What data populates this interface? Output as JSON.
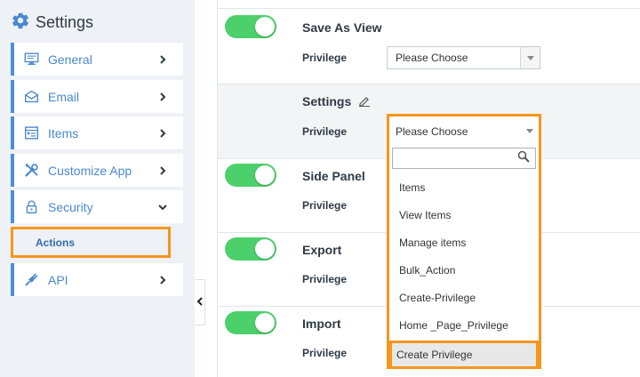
{
  "sidebar": {
    "title": "Settings",
    "header_icon": "gear-icon",
    "items": [
      {
        "label": "General",
        "icon": "monitor-icon",
        "chevron": "chevron-right-icon"
      },
      {
        "label": "Email",
        "icon": "envelope-icon",
        "chevron": "chevron-right-icon"
      },
      {
        "label": "Items",
        "icon": "list-icon",
        "chevron": "chevron-right-icon"
      },
      {
        "label": "Customize App",
        "icon": "tools-icon",
        "chevron": "chevron-right-icon"
      },
      {
        "label": "Security",
        "icon": "lock-icon",
        "chevron": "chevron-down-icon"
      },
      {
        "label": "API",
        "icon": "plug-icon",
        "chevron": "chevron-right-icon"
      }
    ],
    "subitem": {
      "label": "Actions"
    }
  },
  "main": {
    "privilege_label": "Privilege",
    "sections": [
      {
        "title": "Save As View",
        "toggle_on": true,
        "select_value": "Please Choose"
      },
      {
        "title": "Settings",
        "toggle_on": false,
        "edit_icon": "pencil-icon",
        "select_value": "Please Choose"
      },
      {
        "title": "Side Panel",
        "toggle_on": true
      },
      {
        "title": "Export",
        "toggle_on": true
      },
      {
        "title": "Import",
        "toggle_on": true
      }
    ]
  },
  "dropdown": {
    "selected": "Please Choose",
    "search_placeholder": "",
    "options": [
      "Items",
      "View Items",
      "Manage items",
      "Bulk_Action",
      "Create-Privilege",
      "Home _Page_Privilege"
    ],
    "highlighted": "Create Privilege"
  },
  "colors": {
    "accent": "#4a88cf",
    "toggle_on": "#4cd06b",
    "highlight_border": "#f5961e",
    "sidebar_bg": "#eef1f5"
  }
}
